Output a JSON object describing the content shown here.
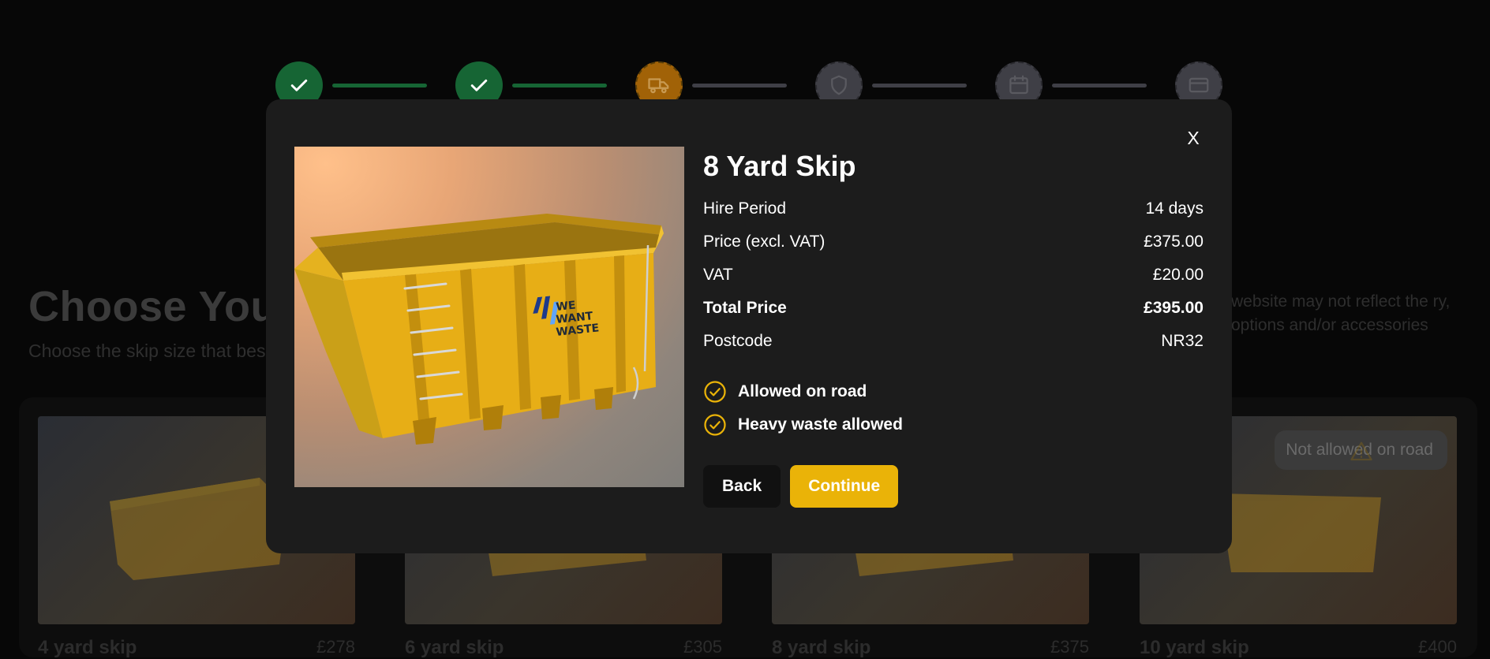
{
  "stepper": {
    "steps": [
      {
        "icon": "check-icon",
        "state": "done"
      },
      {
        "icon": "check-icon",
        "state": "done"
      },
      {
        "icon": "truck-icon",
        "state": "current"
      },
      {
        "icon": "shield-icon",
        "state": "todo"
      },
      {
        "icon": "calendar-icon",
        "state": "todo"
      },
      {
        "icon": "credit-card-icon",
        "state": "todo"
      }
    ]
  },
  "background": {
    "title": "Choose Your",
    "subtitle": "Choose the skip size that bes",
    "note": "website may not reflect the ry, options and/or accessories"
  },
  "cards": [
    {
      "name": "4 yard skip",
      "price": "£278"
    },
    {
      "name": "6 yard skip",
      "price": "£305"
    },
    {
      "name": "8 yard skip",
      "price": "£375"
    },
    {
      "name": "10 yard skip",
      "price": "£400",
      "badge": "Not allowed on road"
    }
  ],
  "modal": {
    "close_label": "X",
    "title": "8 Yard Skip",
    "rows": [
      {
        "label": "Hire Period",
        "value": "14 days"
      },
      {
        "label": "Price (excl. VAT)",
        "value": "£375.00"
      },
      {
        "label": "VAT",
        "value": "£20.00"
      },
      {
        "label": "Total Price",
        "value": "£395.00"
      },
      {
        "label": "Postcode",
        "value": "NR32"
      }
    ],
    "features": [
      "Allowed on road",
      "Heavy waste allowed"
    ],
    "back_label": "Back",
    "continue_label": "Continue",
    "logo_text": [
      "WE",
      "WANT",
      "WASTE"
    ]
  },
  "colors": {
    "accent": "#eab308",
    "step_done": "#166534",
    "step_current": "#a16207",
    "modal_bg": "#1c1c1c"
  }
}
